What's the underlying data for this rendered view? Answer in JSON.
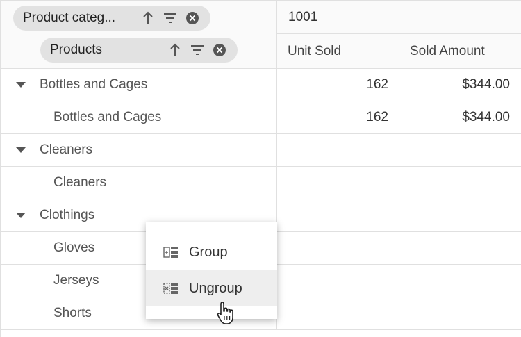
{
  "pivot": {
    "row_header_chips": [
      {
        "label": "Product categ..."
      },
      {
        "label": "Products"
      }
    ],
    "column_header_top": "1001",
    "columns": [
      "Unit Sold",
      "Sold Amount"
    ]
  },
  "rows": [
    {
      "type": "group",
      "label": "Bottles and Cages",
      "unit_sold": "162",
      "sold_amount": "$344.00"
    },
    {
      "type": "child",
      "label": "Bottles and Cages",
      "unit_sold": "162",
      "sold_amount": "$344.00"
    },
    {
      "type": "group",
      "label": "Cleaners",
      "unit_sold": "",
      "sold_amount": ""
    },
    {
      "type": "child",
      "label": "Cleaners",
      "unit_sold": "",
      "sold_amount": ""
    },
    {
      "type": "group",
      "label": "Clothings",
      "unit_sold": "",
      "sold_amount": ""
    },
    {
      "type": "child",
      "label": "Gloves",
      "unit_sold": "",
      "sold_amount": ""
    },
    {
      "type": "child",
      "label": "Jerseys",
      "unit_sold": "",
      "sold_amount": ""
    },
    {
      "type": "child",
      "label": "Shorts",
      "unit_sold": "",
      "sold_amount": ""
    }
  ],
  "context_menu": {
    "items": [
      {
        "label": "Group",
        "icon": "group-icon"
      },
      {
        "label": "Ungroup",
        "icon": "ungroup-icon",
        "hovered": true
      }
    ]
  },
  "colors": {
    "chip_bg": "#e2e2e2",
    "header_bg": "#fafafa",
    "grid_line": "#e0e0e0",
    "menu_hover": "#eeeeee"
  }
}
